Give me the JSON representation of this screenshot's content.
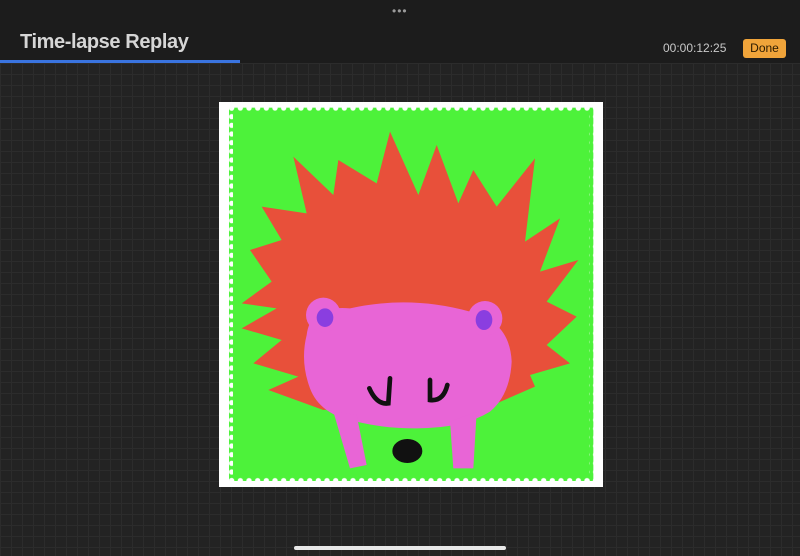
{
  "header": {
    "title": "Time-lapse Replay",
    "timestamp": "00:00:12:25",
    "done_label": "Done",
    "more_icon": "ellipsis-icon"
  },
  "playback": {
    "progress_fraction": 0.3
  },
  "colors": {
    "accent": "#3a74e0",
    "done_button": "#f0a43a",
    "background": "#1c1c1c",
    "stamp_green": "#4df23a",
    "spines": "#e8503a",
    "face": "#e865d6",
    "ear_inner": "#8a3ee0"
  },
  "artwork": {
    "subject": "hedgehog stamp illustration"
  }
}
